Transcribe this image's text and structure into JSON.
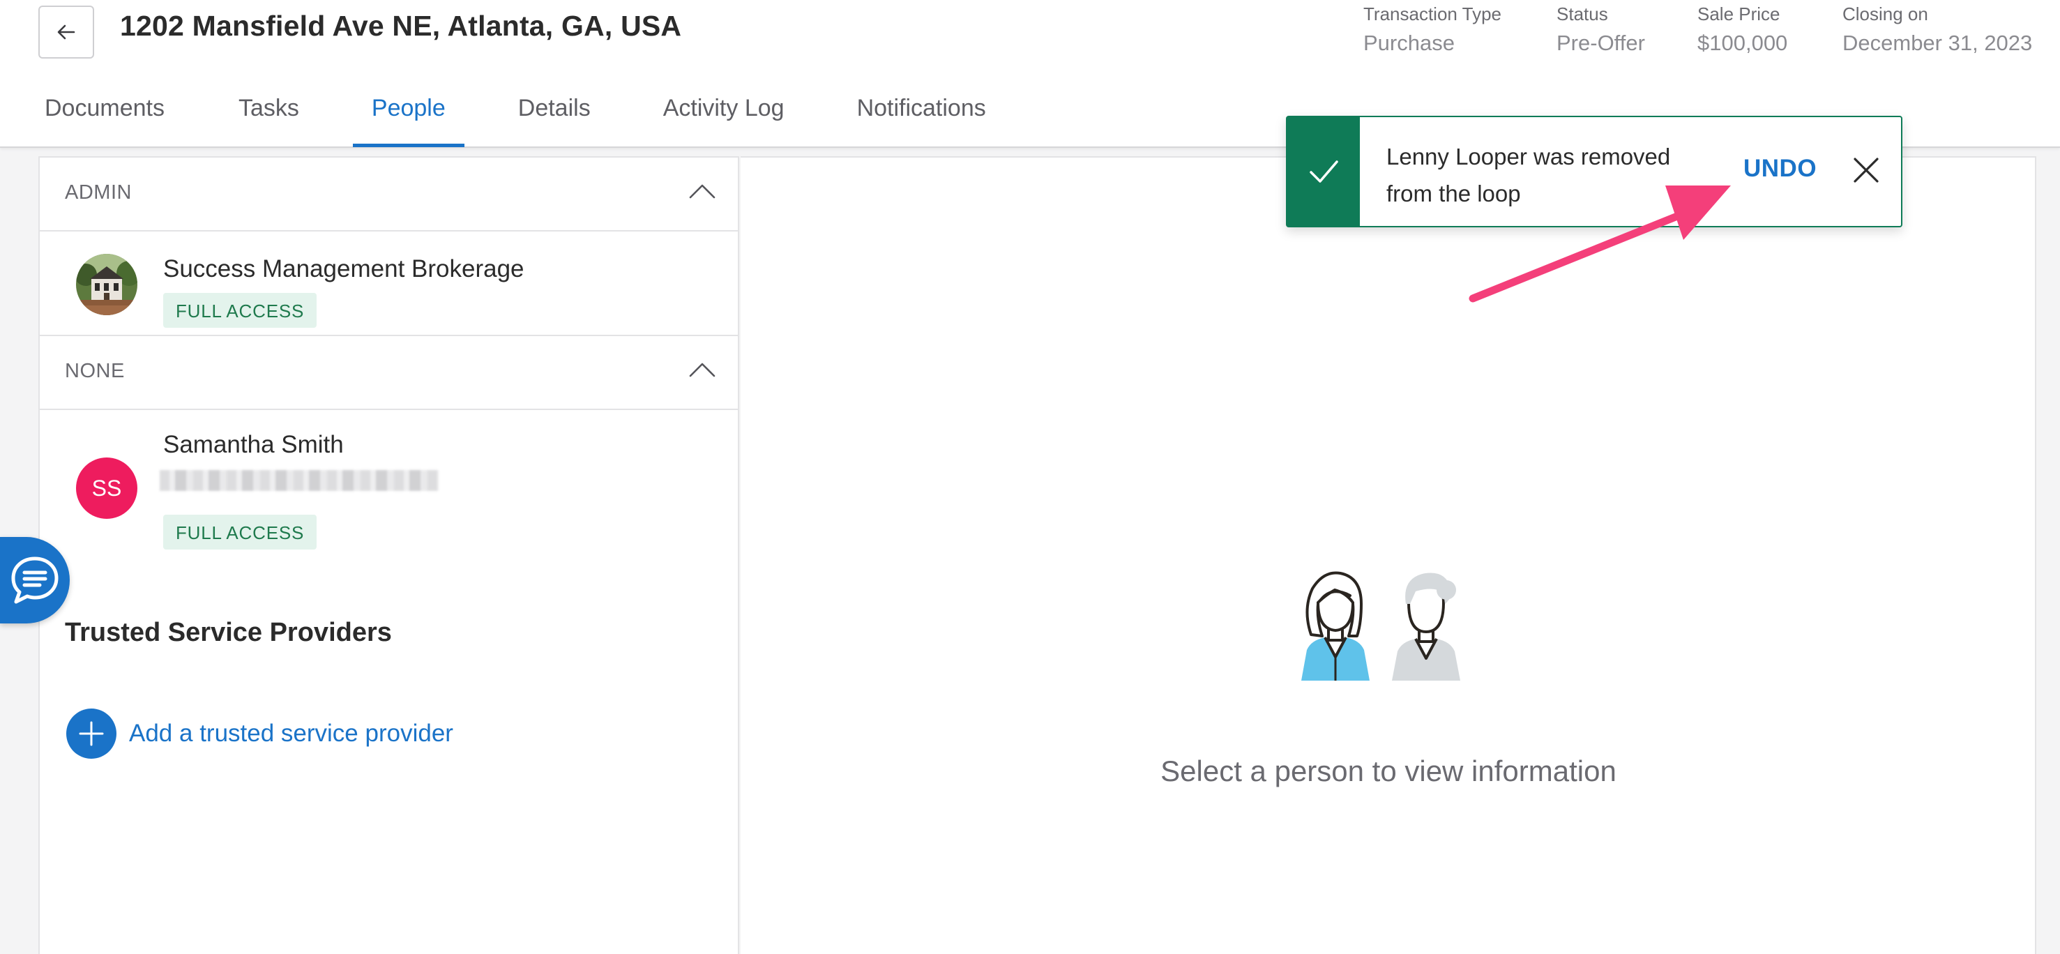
{
  "header": {
    "title": "1202 Mansfield Ave NE, Atlanta, GA, USA",
    "meta": [
      {
        "label": "Transaction Type",
        "value": "Purchase"
      },
      {
        "label": "Status",
        "value": "Pre-Offer"
      },
      {
        "label": "Sale Price",
        "value": "$100,000"
      },
      {
        "label": "Closing on",
        "value": "December 31, 2023"
      }
    ]
  },
  "tabs": [
    {
      "label": "Documents"
    },
    {
      "label": "Tasks"
    },
    {
      "label": "People",
      "active": true
    },
    {
      "label": "Details"
    },
    {
      "label": "Activity Log"
    },
    {
      "label": "Notifications"
    }
  ],
  "people": {
    "sections": [
      {
        "title": "ADMIN",
        "members": [
          {
            "name": "Success Management Brokerage",
            "access": "FULL ACCESS",
            "avatar": "photo"
          }
        ]
      },
      {
        "title": "NONE",
        "members": [
          {
            "name": "Samantha Smith",
            "initials": "SS",
            "access": "FULL ACCESS"
          }
        ]
      }
    ],
    "trusted_title": "Trusted Service Providers",
    "add_provider_label": "Add a trusted service provider"
  },
  "detail": {
    "empty_text": "Select a person to view information"
  },
  "toast": {
    "message": "Lenny Looper was removed from the loop",
    "undo_label": "UNDO"
  },
  "colors": {
    "accent": "#1a73c8",
    "success": "#0f7b57",
    "badge_bg": "#e3f3ec",
    "badge_text": "#1f7a4d",
    "avatar_ss": "#ee1c5e",
    "annotation_arrow": "#f43f7a"
  },
  "icons": {
    "back": "arrow-left-icon",
    "collapse": "chevron-up-icon",
    "chat": "chat-icon",
    "add": "plus-icon",
    "toast_status": "check-icon",
    "toast_close": "close-icon"
  }
}
